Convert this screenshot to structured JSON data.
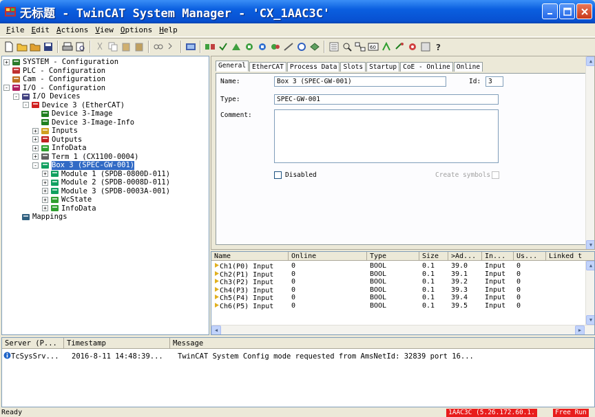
{
  "titlebar": {
    "title": "无标题 - TwinCAT System Manager - 'CX_1AAC3C'"
  },
  "menu": [
    {
      "text": "File",
      "key": "F"
    },
    {
      "text": "Edit",
      "key": "E"
    },
    {
      "text": "Actions",
      "key": "A"
    },
    {
      "text": "View",
      "key": "V"
    },
    {
      "text": "Options",
      "key": "O"
    },
    {
      "text": "Help",
      "key": "H"
    }
  ],
  "tree": [
    {
      "label": "SYSTEM - Configuration",
      "level": 0,
      "exp": "+",
      "icon": "system-icon",
      "color": "#2a7a2a"
    },
    {
      "label": "PLC - Configuration",
      "level": 0,
      "exp": "",
      "icon": "plc-icon",
      "color": "#c03030"
    },
    {
      "label": "Cam - Configuration",
      "level": 0,
      "exp": "",
      "icon": "cam-icon",
      "color": "#c07020"
    },
    {
      "label": "I/O - Configuration",
      "level": 0,
      "exp": "-",
      "icon": "io-config-icon",
      "color": "#b02060"
    },
    {
      "label": "I/O Devices",
      "level": 1,
      "exp": "-",
      "icon": "io-devices-icon",
      "color": "#404080"
    },
    {
      "label": "Device 3 (EtherCAT)",
      "level": 2,
      "exp": "-",
      "icon": "ethercat-device-icon",
      "color": "#d02020"
    },
    {
      "label": "Device 3-Image",
      "level": 3,
      "exp": "",
      "icon": "image-icon",
      "color": "#208020"
    },
    {
      "label": "Device 3-Image-Info",
      "level": 3,
      "exp": "",
      "icon": "image-info-icon",
      "color": "#208020"
    },
    {
      "label": "Inputs",
      "level": 3,
      "exp": "+",
      "icon": "inputs-icon",
      "color": "#d0a020"
    },
    {
      "label": "Outputs",
      "level": 3,
      "exp": "+",
      "icon": "outputs-icon",
      "color": "#c02020"
    },
    {
      "label": "InfoData",
      "level": 3,
      "exp": "+",
      "icon": "infodata-icon",
      "color": "#30a030"
    },
    {
      "label": "Term 1 (CX1100-0004)",
      "level": 3,
      "exp": "+",
      "icon": "terminal-icon",
      "color": "#606060"
    },
    {
      "label": "Box 3 (SPEC-GW-001)",
      "level": 3,
      "exp": "-",
      "icon": "box-icon",
      "color": "#10a060",
      "selected": true
    },
    {
      "label": "Module 1 (SPDB-0800D-011)",
      "level": 4,
      "exp": "+",
      "icon": "module-icon",
      "color": "#10a060"
    },
    {
      "label": "Module 2 (SPDB-0008D-011)",
      "level": 4,
      "exp": "+",
      "icon": "module-icon",
      "color": "#10a060"
    },
    {
      "label": "Module 3 (SPDB-0003A-001)",
      "level": 4,
      "exp": "+",
      "icon": "module-icon",
      "color": "#10a060"
    },
    {
      "label": "WcState",
      "level": 4,
      "exp": "+",
      "icon": "wcstate-icon",
      "color": "#30a030"
    },
    {
      "label": "InfoData",
      "level": 4,
      "exp": "+",
      "icon": "infodata-icon",
      "color": "#30a030"
    },
    {
      "label": "Mappings",
      "level": 1,
      "exp": "",
      "icon": "mappings-icon",
      "color": "#306080"
    }
  ],
  "tabs": [
    "General",
    "EtherCAT",
    "Process Data",
    "Slots",
    "Startup",
    "CoE - Online",
    "Online"
  ],
  "general": {
    "name_label": "Name:",
    "name_value": "Box 3 (SPEC-GW-001)",
    "id_label": "Id:",
    "id_value": "3",
    "type_label": "Type:",
    "type_value": "SPEC-GW-001",
    "comment_label": "Comment:",
    "comment_value": "",
    "disabled_label": "Disabled",
    "create_symbols_label": "Create symbols"
  },
  "var_table": {
    "columns": [
      "Name",
      "Online",
      "Type",
      "Size",
      ">Ad...",
      "In...",
      "Us...",
      "Linked t"
    ],
    "rows": [
      [
        "Ch1(P0) Input",
        "0",
        "BOOL",
        "0.1",
        "39.0",
        "Input",
        "0",
        ""
      ],
      [
        "Ch2(P1) Input",
        "0",
        "BOOL",
        "0.1",
        "39.1",
        "Input",
        "0",
        ""
      ],
      [
        "Ch3(P2) Input",
        "0",
        "BOOL",
        "0.1",
        "39.2",
        "Input",
        "0",
        ""
      ],
      [
        "Ch4(P3) Input",
        "0",
        "BOOL",
        "0.1",
        "39.3",
        "Input",
        "0",
        ""
      ],
      [
        "Ch5(P4) Input",
        "0",
        "BOOL",
        "0.1",
        "39.4",
        "Input",
        "0",
        ""
      ],
      [
        "Ch6(P5) Input",
        "0",
        "BOOL",
        "0.1",
        "39.5",
        "Input",
        "0",
        ""
      ]
    ]
  },
  "log": {
    "columns": [
      "Server (P...",
      "Timestamp",
      "Message"
    ],
    "rows": [
      {
        "server": "TcSysSrv...",
        "timestamp": "2016-8-11 14:48:39...",
        "message": "TwinCAT System Config mode requested from AmsNetId: 32839 port 16..."
      }
    ]
  },
  "status": {
    "text": "Ready",
    "ams": "1AAC3C (5.26.172.60.1.",
    "mode": "Free Run"
  },
  "colors": {
    "accent": "#316ac5",
    "status_red": "#e81c1c"
  }
}
